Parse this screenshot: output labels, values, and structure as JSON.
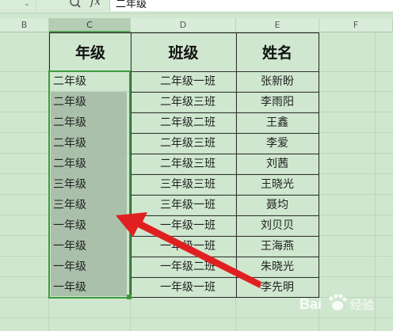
{
  "formula_bar": {
    "value": "二年级"
  },
  "column_headers": [
    "B",
    "C",
    "D",
    "E",
    "F"
  ],
  "table": {
    "headers": [
      "年级",
      "班级",
      "姓名"
    ],
    "rows": [
      [
        "二年级",
        "二年级一班",
        "张新盼"
      ],
      [
        "二年级",
        "二年级三班",
        "李雨阳"
      ],
      [
        "二年级",
        "二年级二班",
        "王鑫"
      ],
      [
        "二年级",
        "二年级三班",
        "李爱"
      ],
      [
        "二年级",
        "二年级三班",
        "刘茜"
      ],
      [
        "三年级",
        "三年级三班",
        "王晓光"
      ],
      [
        "三年级",
        "三年级一班",
        "聂均"
      ],
      [
        "一年级",
        "一年级一班",
        "刘贝贝"
      ],
      [
        "一年级",
        "一年级一班",
        "王海燕"
      ],
      [
        "一年级",
        "一年级二班",
        "朱晓光"
      ],
      [
        "一年级",
        "一年级一班",
        "李先明"
      ]
    ]
  },
  "watermark": {
    "text": "Bai",
    "text2": "经验"
  },
  "colors": {
    "sheet_bg": "#cfe7cf",
    "selection_border": "#3f9a3f",
    "arrow": "#e02020"
  }
}
